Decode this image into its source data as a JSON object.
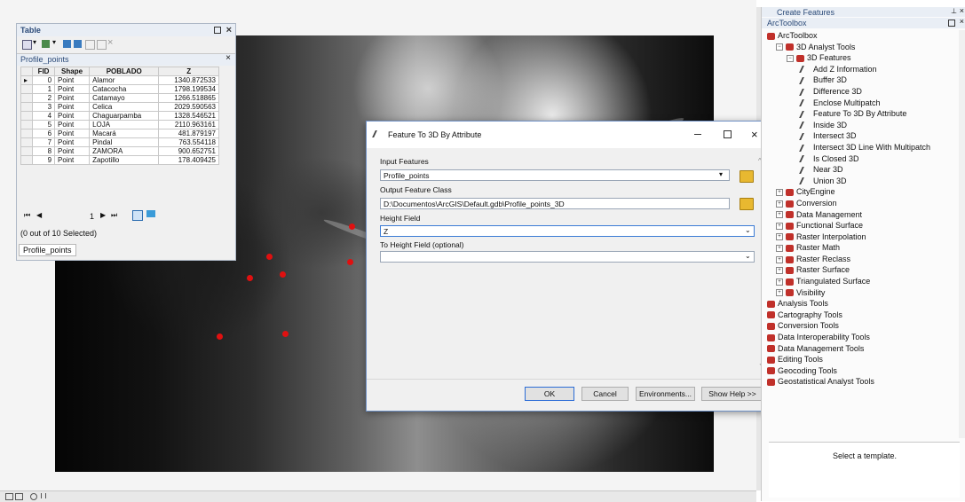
{
  "table": {
    "title": "Table",
    "tab_name": "Profile_points",
    "columns": [
      "FID",
      "Shape",
      "POBLADO",
      "Z"
    ],
    "rows": [
      [
        "0",
        "Point",
        "Alamor",
        "1340.872533"
      ],
      [
        "1",
        "Point",
        "Catacocha",
        "1798.199534"
      ],
      [
        "2",
        "Point",
        "Catamayo",
        "1266.518865"
      ],
      [
        "3",
        "Point",
        "Celica",
        "2029.590563"
      ],
      [
        "4",
        "Point",
        "Chaguarpamba",
        "1328.546521"
      ],
      [
        "5",
        "Point",
        "LOJA",
        "2110.963161"
      ],
      [
        "6",
        "Point",
        "Macará",
        "481.879197"
      ],
      [
        "7",
        "Point",
        "Pindal",
        "763.554118"
      ],
      [
        "8",
        "Point",
        "ZAMORA",
        "900.652751"
      ],
      [
        "9",
        "Point",
        "Zapotillo",
        "178.409425"
      ]
    ],
    "nav_record": "1",
    "selection_status": "(0 out of 10 Selected)",
    "bottom_tab": "Profile_points"
  },
  "dialog": {
    "title": "Feature To 3D By Attribute",
    "input_features_label": "Input Features",
    "input_features_value": "Profile_points",
    "output_class_label": "Output Feature Class",
    "output_class_value": "D:\\Documentos\\ArcGIS\\Default.gdb\\Profile_points_3D",
    "height_field_label": "Height Field",
    "height_field_value": "Z",
    "to_height_label": "To Height Field (optional)",
    "to_height_value": "",
    "ok": "OK",
    "cancel": "Cancel",
    "environments": "Environments...",
    "show_help": "Show Help >>"
  },
  "right_panel": {
    "create_features_tab": "Create Features",
    "arctoolbox_title": "ArcToolbox",
    "root": "ArcToolbox",
    "analyst": "3D Analyst Tools",
    "features_toolset": "3D Features",
    "tools": [
      "Add Z Information",
      "Buffer 3D",
      "Difference 3D",
      "Enclose Multipatch",
      "Feature To 3D By Attribute",
      "Inside 3D",
      "Intersect 3D",
      "Intersect 3D Line With Multipatch",
      "Is Closed 3D",
      "Near 3D",
      "Union 3D"
    ],
    "toolsets": [
      "CityEngine",
      "Conversion",
      "Data Management",
      "Functional Surface",
      "Raster Interpolation",
      "Raster Math",
      "Raster Reclass",
      "Raster Surface",
      "Triangulated Surface",
      "Visibility"
    ],
    "toolboxes": [
      "Analysis Tools",
      "Cartography Tools",
      "Conversion Tools",
      "Data Interoperability Tools",
      "Data Management Tools",
      "Editing Tools",
      "Geocoding Tools",
      "Geostatistical Analyst Tools"
    ],
    "select_template": "Select a template."
  },
  "colors": {
    "point": "#e01010",
    "accent": "#2b4a78",
    "toolbox_red": "#c0302a"
  }
}
